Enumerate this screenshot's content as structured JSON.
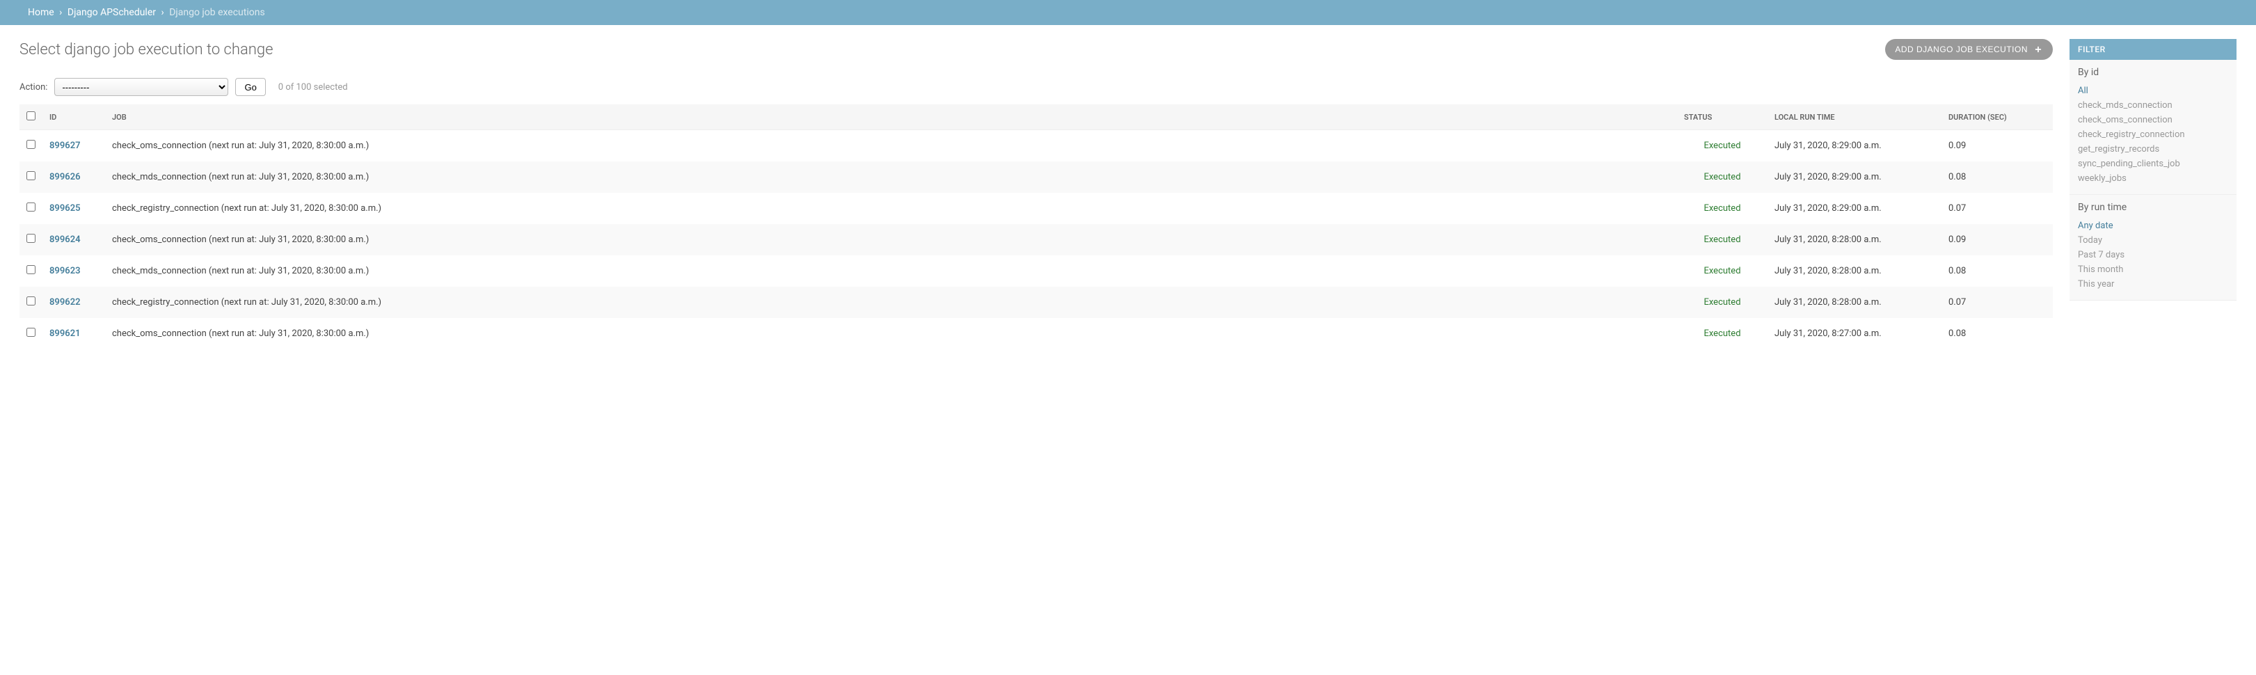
{
  "breadcrumbs": {
    "home": "Home",
    "app": "Django APScheduler",
    "current": "Django job executions"
  },
  "page_title": "Select django job execution to change",
  "add_button": "ADD DJANGO JOB EXECUTION",
  "actions": {
    "label": "Action:",
    "placeholder": "---------",
    "go": "Go",
    "counter": "0 of 100 selected"
  },
  "columns": {
    "id": "ID",
    "job": "JOB",
    "status": "STATUS",
    "run_time": "LOCAL RUN TIME",
    "duration": "DURATION (SEC)"
  },
  "rows": [
    {
      "id": "899627",
      "job": "check_oms_connection (next run at: July 31, 2020, 8:30:00 a.m.)",
      "status": "Executed",
      "run_time": "July 31, 2020, 8:29:00 a.m.",
      "duration": "0.09"
    },
    {
      "id": "899626",
      "job": "check_mds_connection (next run at: July 31, 2020, 8:30:00 a.m.)",
      "status": "Executed",
      "run_time": "July 31, 2020, 8:29:00 a.m.",
      "duration": "0.08"
    },
    {
      "id": "899625",
      "job": "check_registry_connection (next run at: July 31, 2020, 8:30:00 a.m.)",
      "status": "Executed",
      "run_time": "July 31, 2020, 8:29:00 a.m.",
      "duration": "0.07"
    },
    {
      "id": "899624",
      "job": "check_oms_connection (next run at: July 31, 2020, 8:30:00 a.m.)",
      "status": "Executed",
      "run_time": "July 31, 2020, 8:28:00 a.m.",
      "duration": "0.09"
    },
    {
      "id": "899623",
      "job": "check_mds_connection (next run at: July 31, 2020, 8:30:00 a.m.)",
      "status": "Executed",
      "run_time": "July 31, 2020, 8:28:00 a.m.",
      "duration": "0.08"
    },
    {
      "id": "899622",
      "job": "check_registry_connection (next run at: July 31, 2020, 8:30:00 a.m.)",
      "status": "Executed",
      "run_time": "July 31, 2020, 8:28:00 a.m.",
      "duration": "0.07"
    },
    {
      "id": "899621",
      "job": "check_oms_connection (next run at: July 31, 2020, 8:30:00 a.m.)",
      "status": "Executed",
      "run_time": "July 31, 2020, 8:27:00 a.m.",
      "duration": "0.08"
    }
  ],
  "filters": {
    "header": "FILTER",
    "by_id": {
      "title": "By id",
      "items": [
        {
          "label": "All",
          "selected": true
        },
        {
          "label": "check_mds_connection",
          "selected": false
        },
        {
          "label": "check_oms_connection",
          "selected": false
        },
        {
          "label": "check_registry_connection",
          "selected": false
        },
        {
          "label": "get_registry_records",
          "selected": false
        },
        {
          "label": "sync_pending_clients_job",
          "selected": false
        },
        {
          "label": "weekly_jobs",
          "selected": false
        }
      ]
    },
    "by_run_time": {
      "title": "By run time",
      "items": [
        {
          "label": "Any date",
          "selected": true
        },
        {
          "label": "Today",
          "selected": false
        },
        {
          "label": "Past 7 days",
          "selected": false
        },
        {
          "label": "This month",
          "selected": false
        },
        {
          "label": "This year",
          "selected": false
        }
      ]
    }
  }
}
